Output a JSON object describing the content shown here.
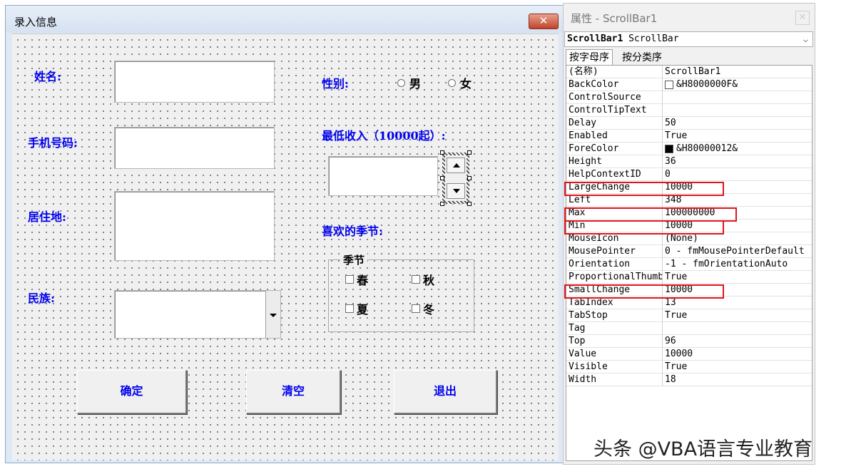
{
  "form": {
    "title": "录入信息",
    "close_glyph": "✕",
    "labels": {
      "name": "姓名:",
      "phone": "手机号码:",
      "address": "居住地:",
      "ethnicity": "民族:",
      "gender": "性别:",
      "min_income": "最低收入（10000起）:",
      "season": "喜欢的季节:"
    },
    "gender_options": [
      "男",
      "女"
    ],
    "season_frame_caption": "季节",
    "season_options": [
      "春",
      "秋",
      "夏",
      "冬"
    ],
    "buttons": {
      "ok": "确定",
      "clear": "清空",
      "exit": "退出"
    }
  },
  "properties": {
    "title": "属性 - ScrollBar1",
    "close_glyph": "✕",
    "object_name": "ScrollBar1",
    "object_type": "ScrollBar",
    "dropdown_glyph": "⌵",
    "tabs": [
      "按字母序",
      "按分类序"
    ],
    "rows": [
      {
        "name": "(名称)",
        "value": "ScrollBar1"
      },
      {
        "name": "BackColor",
        "value": "&H8000000F&",
        "swatch": "#ffffff"
      },
      {
        "name": "ControlSource",
        "value": ""
      },
      {
        "name": "ControlTipText",
        "value": ""
      },
      {
        "name": "Delay",
        "value": "50"
      },
      {
        "name": "Enabled",
        "value": "True"
      },
      {
        "name": "ForeColor",
        "value": "&H80000012&",
        "swatch": "#000000"
      },
      {
        "name": "Height",
        "value": "36"
      },
      {
        "name": "HelpContextID",
        "value": "0"
      },
      {
        "name": "LargeChange",
        "value": "10000",
        "highlight": true
      },
      {
        "name": "Left",
        "value": "348"
      },
      {
        "name": "Max",
        "value": "100000000",
        "highlight": true
      },
      {
        "name": "Min",
        "value": "10000",
        "highlight": true
      },
      {
        "name": "MouseIcon",
        "value": "(None)"
      },
      {
        "name": "MousePointer",
        "value": "0 - fmMousePointerDefault"
      },
      {
        "name": "Orientation",
        "value": "-1 - fmOrientationAuto"
      },
      {
        "name": "ProportionalThumb",
        "value": "True"
      },
      {
        "name": "SmallChange",
        "value": "10000",
        "highlight": true
      },
      {
        "name": "TabIndex",
        "value": "13"
      },
      {
        "name": "TabStop",
        "value": "True"
      },
      {
        "name": "Tag",
        "value": ""
      },
      {
        "name": "Top",
        "value": "96"
      },
      {
        "name": "Value",
        "value": "10000"
      },
      {
        "name": "Visible",
        "value": "True"
      },
      {
        "name": "Width",
        "value": "18"
      }
    ]
  },
  "watermark": "头条 @VBA语言专业教育",
  "colors": {
    "label_blue": "#0000ee",
    "highlight_red": "#e0141e",
    "close_red": "#c0442a"
  }
}
